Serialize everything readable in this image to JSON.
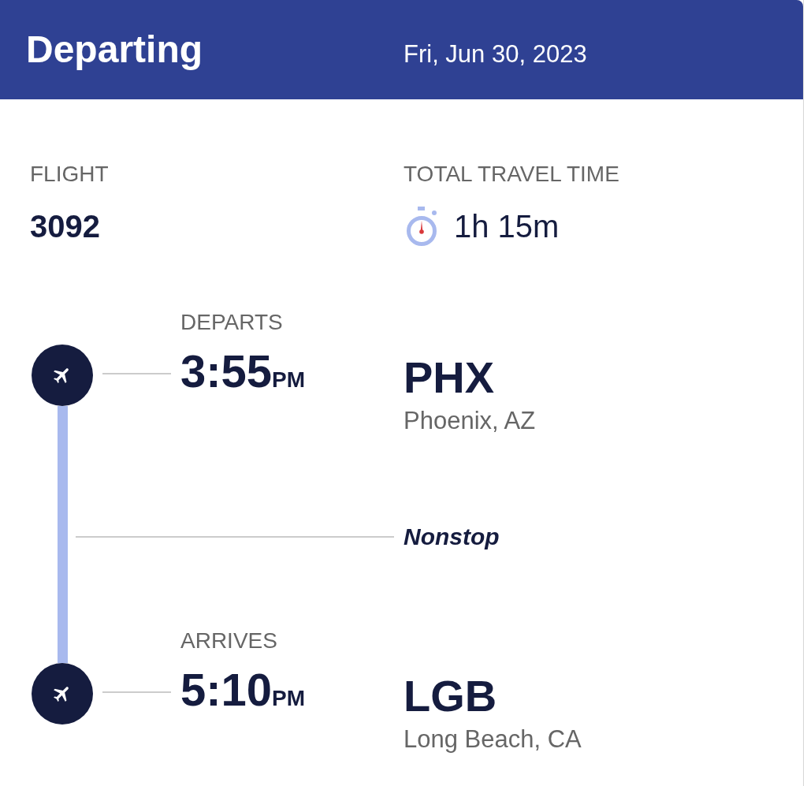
{
  "header": {
    "title": "Departing",
    "date": "Fri, Jun 30, 2023"
  },
  "flight": {
    "label": "FLIGHT",
    "number": "3092"
  },
  "travel_time": {
    "label": "TOTAL TRAVEL TIME",
    "duration": "1h 15m"
  },
  "segments": [
    {
      "label": "DEPARTS",
      "time": "3:55",
      "meridiem": "PM",
      "airport_code": "PHX",
      "city": "Phoenix, AZ"
    },
    {
      "label": "ARRIVES",
      "time": "5:10",
      "meridiem": "PM",
      "airport_code": "LGB",
      "city": "Long Beach, CA"
    }
  ],
  "stops": "Nonstop"
}
